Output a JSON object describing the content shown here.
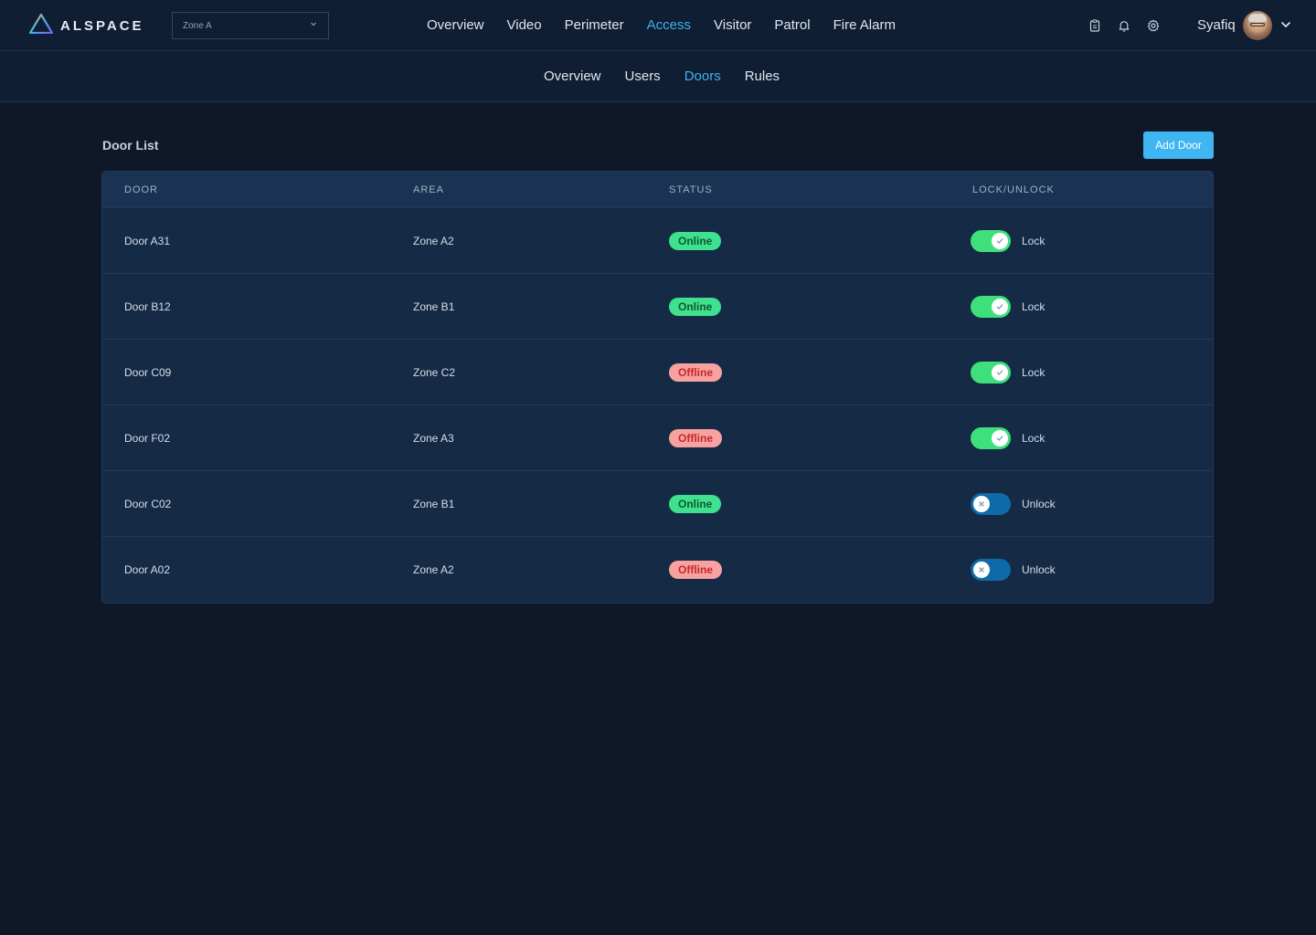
{
  "app": {
    "logo_text": "ALSPACE",
    "zone_select": "Zone A"
  },
  "main_nav": [
    {
      "label": "Overview",
      "active": false
    },
    {
      "label": "Video",
      "active": false
    },
    {
      "label": "Perimeter",
      "active": false
    },
    {
      "label": "Access",
      "active": true
    },
    {
      "label": "Visitor",
      "active": false
    },
    {
      "label": "Patrol",
      "active": false
    },
    {
      "label": "Fire Alarm",
      "active": false
    }
  ],
  "header_icons": [
    "clipboard-icon",
    "bell-icon",
    "gear-icon"
  ],
  "user": {
    "name": "Syafiq"
  },
  "sub_nav": [
    {
      "label": "Overview",
      "active": false
    },
    {
      "label": "Users",
      "active": false
    },
    {
      "label": "Doors",
      "active": true
    },
    {
      "label": "Rules",
      "active": false
    }
  ],
  "content": {
    "title": "Door List",
    "add_button": "Add Door"
  },
  "table": {
    "headers": [
      "DOOR",
      "AREA",
      "STATUS",
      "LOCK/UNLOCK"
    ],
    "rows": [
      {
        "door": "Door A31",
        "area": "Zone A2",
        "status": "Online",
        "locked": true,
        "lock_label": "Lock"
      },
      {
        "door": "Door B12",
        "area": "Zone B1",
        "status": "Online",
        "locked": true,
        "lock_label": "Lock"
      },
      {
        "door": "Door C09",
        "area": "Zone C2",
        "status": "Offline",
        "locked": true,
        "lock_label": "Lock"
      },
      {
        "door": "Door F02",
        "area": "Zone A3",
        "status": "Offline",
        "locked": true,
        "lock_label": "Lock"
      },
      {
        "door": "Door C02",
        "area": "Zone B1",
        "status": "Online",
        "locked": false,
        "lock_label": "Unlock"
      },
      {
        "door": "Door A02",
        "area": "Zone A2",
        "status": "Offline",
        "locked": false,
        "lock_label": "Unlock"
      }
    ]
  },
  "colors": {
    "background": "#0e1828",
    "accent": "#3fb2ec",
    "online": "#3fe08e",
    "offline": "#f7a1a1",
    "toggle_on": "#3ee07c",
    "toggle_off": "#0e6aa8"
  }
}
